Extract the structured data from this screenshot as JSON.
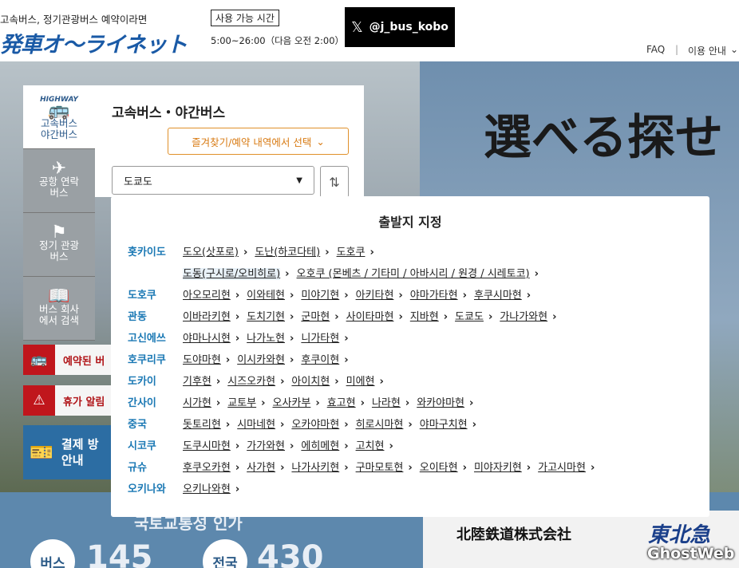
{
  "header": {
    "tagline": "고속버스, 정기관광버스 예약이라면",
    "logo": "発車オ～ライネット",
    "hours_badge": "사용 가능 시간",
    "hours": "5:00~26:00（다음 오전 2:00）",
    "x_handle": "@j_bus_kobo",
    "nav": [
      "FAQ",
      "이용 안내"
    ]
  },
  "sidebar": {
    "items": [
      {
        "label": "고속버스\n야간버스",
        "badge": "HIGHWAY",
        "icon": "bus-icon"
      },
      {
        "label": "공항 연락\n버스",
        "icon": "airplane-icon"
      },
      {
        "label": "정기 관광\n버스",
        "icon": "flag-icon"
      },
      {
        "label": "버스 회사\n에서 검색",
        "icon": "book-icon"
      }
    ]
  },
  "search_panel": {
    "title": "고속버스・야간버스",
    "favorites_button": "즐겨찾기/예약 내역에서 선택",
    "origin_select": "도쿄도"
  },
  "alerts": {
    "reserved": "예약된 버",
    "holiday": "휴가 알림",
    "payment": "결제 방\n안내"
  },
  "banner": {
    "headline": "選べる探せ",
    "ministry_text": "국토교통성 인가",
    "bus_circle": "버스",
    "bus_number": "145",
    "nation_circle": "전국",
    "nation_number": "430",
    "company1": "北陸鉄道株式会社",
    "company2": "東北急"
  },
  "modal": {
    "title": "출발지 지정",
    "regions": [
      {
        "name": "홋카이도",
        "items": [
          "도오(삿포로)",
          "도난(하코다테)",
          "도호쿠"
        ]
      },
      {
        "name": "",
        "items": [
          "도동(구시로/오비히로)",
          "오호쿠 (몬베츠 / 기타미 / 아바시리 / 원경 / 시레토코)"
        ]
      },
      {
        "name": "도호쿠",
        "items": [
          "아오모리현",
          "이와테현",
          "미야기현",
          "아키타현",
          "야마가타현",
          "후쿠시마현"
        ]
      },
      {
        "name": "관동",
        "items": [
          "이바라키현",
          "도치기현",
          "군마현",
          "사이타마현",
          "지바현",
          "도쿄도",
          "가나가와현"
        ]
      },
      {
        "name": "고신에쓰",
        "items": [
          "야마나시현",
          "나가노현",
          "니가타현"
        ]
      },
      {
        "name": "호쿠리쿠",
        "items": [
          "도야마현",
          "이시카와현",
          "후쿠이현"
        ]
      },
      {
        "name": "도카이",
        "items": [
          "기후현",
          "시즈오카현",
          "아이치현",
          "미에현"
        ]
      },
      {
        "name": "간사이",
        "items": [
          "시가현",
          "교토부",
          "오사카부",
          "효고현",
          "나라현",
          "와카야마현"
        ]
      },
      {
        "name": "중국",
        "items": [
          "돗토리현",
          "시마네현",
          "오카야마현",
          "히로시마현",
          "야마구치현"
        ]
      },
      {
        "name": "시코쿠",
        "items": [
          "도쿠시마현",
          "가가와현",
          "에히메현",
          "고치현"
        ]
      },
      {
        "name": "규슈",
        "items": [
          "후쿠오카현",
          "사가현",
          "나가사키현",
          "구마모토현",
          "오이타현",
          "미야자키현",
          "가고시마현"
        ]
      },
      {
        "name": "오키나와",
        "items": [
          "오키나와현"
        ]
      }
    ]
  },
  "watermark": "GhostWeb"
}
